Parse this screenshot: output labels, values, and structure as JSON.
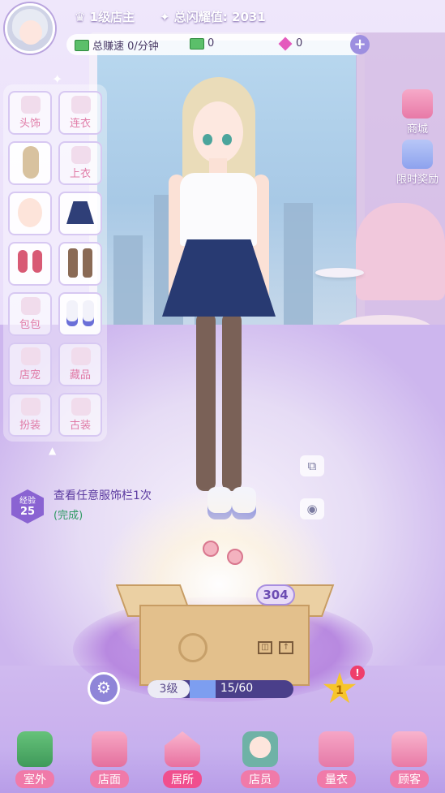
{
  "header": {
    "shop_level": "1级店主",
    "total_glow_label": "总闪耀值:",
    "total_glow_value": "2031",
    "earn_speed": "总赚速 0/分钟",
    "cash": "0",
    "gems": "0",
    "plus_symbol": "+"
  },
  "wardrobe": {
    "slots": [
      {
        "label": "头饰"
      },
      {
        "label": "连衣"
      },
      {
        "label": ""
      },
      {
        "label": "上衣"
      },
      {
        "label": ""
      },
      {
        "label": ""
      },
      {
        "label": ""
      },
      {
        "label": ""
      },
      {
        "label": "包包"
      },
      {
        "label": ""
      },
      {
        "label": "店宠"
      },
      {
        "label": "藏品"
      },
      {
        "label": "扮装"
      },
      {
        "label": "古装"
      }
    ]
  },
  "task": {
    "exp_label": "经验",
    "exp_value": "25",
    "text": "查看任意服饰栏1次",
    "status": "(完成)"
  },
  "side_buttons": {
    "mall": "商城",
    "limited_reward": "限时奖励"
  },
  "box": {
    "bubble_value": "304",
    "level_label": "3级",
    "progress_text": "15/60",
    "progress_fraction": 0.25,
    "star_count": "1",
    "alert": "!"
  },
  "nav": [
    {
      "label": "室外",
      "icon": "palm-tree-icon"
    },
    {
      "label": "店面",
      "icon": "storefront-icon"
    },
    {
      "label": "居所",
      "icon": "house-icon"
    },
    {
      "label": "店员",
      "icon": "staff-icon"
    },
    {
      "label": "量衣",
      "icon": "measure-tape-icon"
    },
    {
      "label": "顾客",
      "icon": "customer-icon"
    }
  ]
}
